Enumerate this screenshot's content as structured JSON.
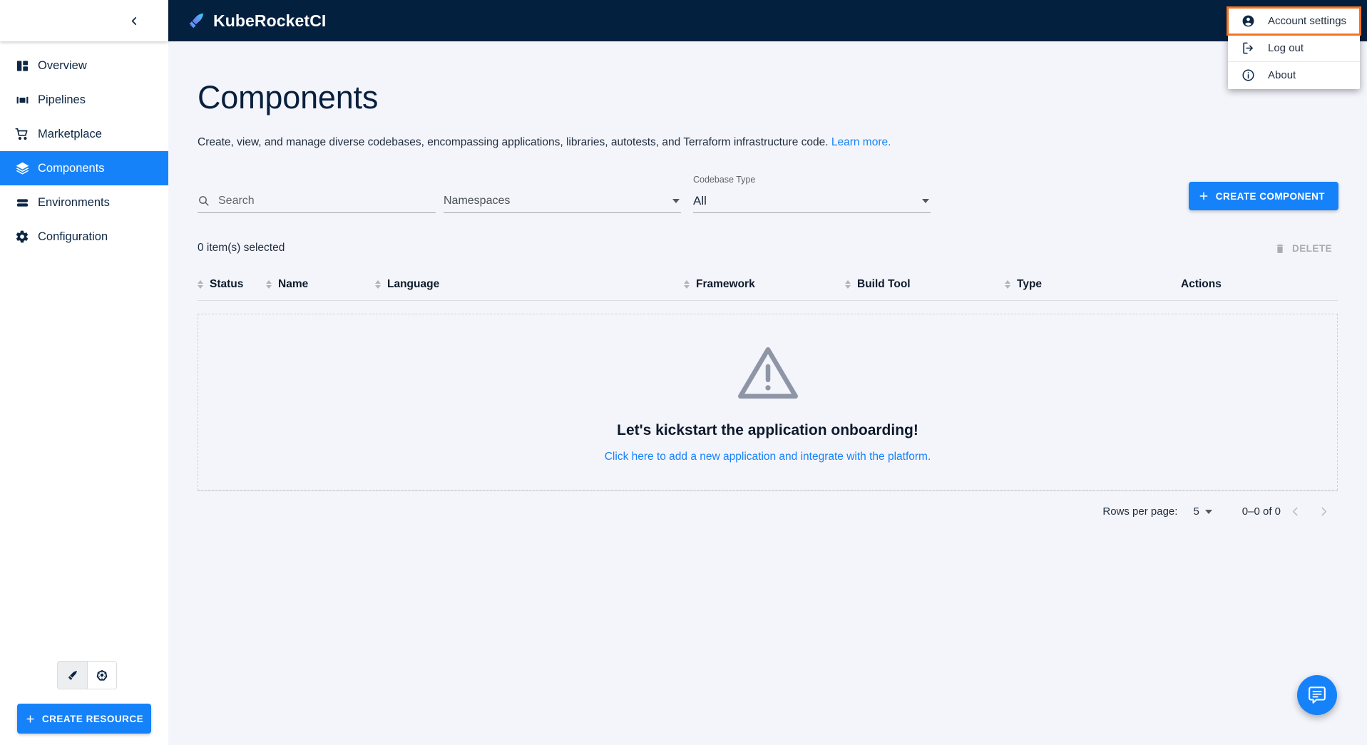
{
  "header": {
    "brand_title": "KubeRocketCI",
    "brand_logo_icon": "rocket-pen-icon"
  },
  "sidebar": {
    "collapse_icon": "chevron-left-icon",
    "items": [
      {
        "label": "Overview",
        "icon": "dashboard-icon",
        "active": false
      },
      {
        "label": "Pipelines",
        "icon": "pipeline-icon",
        "active": false
      },
      {
        "label": "Marketplace",
        "icon": "cart-icon",
        "active": false
      },
      {
        "label": "Components",
        "icon": "layers-icon",
        "active": true
      },
      {
        "label": "Environments",
        "icon": "stack-rows-icon",
        "active": false
      },
      {
        "label": "Configuration",
        "icon": "gear-icon",
        "active": false
      }
    ],
    "cluster_toggles": [
      {
        "icon": "kuberocketci-icon",
        "selected": true
      },
      {
        "icon": "kubernetes-icon",
        "selected": false
      }
    ],
    "create_resource_label": "CREATE RESOURCE",
    "create_resource_icon": "plus-icon"
  },
  "account_menu": {
    "items": [
      {
        "label": "Account settings",
        "icon": "account-circle-icon",
        "highlighted": true
      },
      {
        "label": "Log out",
        "icon": "logout-icon",
        "highlighted": false
      },
      {
        "label": "About",
        "icon": "info-circle-icon",
        "highlighted": false
      }
    ],
    "highlight_color": "#f47421"
  },
  "main": {
    "title": "Components",
    "description": "Create, view, and manage diverse codebases, encompassing applications, libraries, autotests, and Terraform infrastructure code.",
    "learn_more_label": "Learn more.",
    "filters": {
      "search_placeholder": "Search",
      "search_value": "",
      "search_icon": "search-icon",
      "namespaces_label": "Namespaces",
      "namespaces_value": "",
      "codebase_type_label": "Codebase Type",
      "codebase_type_value": "All",
      "dropdown_icon": "chevron-down-icon"
    },
    "create_component_label": "CREATE COMPONENT",
    "create_component_icon": "plus-icon",
    "selection_text": "0 item(s) selected",
    "delete_label": "DELETE",
    "delete_icon": "trash-icon",
    "table": {
      "columns": [
        {
          "label": "Status",
          "sortable": true
        },
        {
          "label": "Name",
          "sortable": true
        },
        {
          "label": "Language",
          "sortable": true
        },
        {
          "label": "Framework",
          "sortable": true
        },
        {
          "label": "Build Tool",
          "sortable": true
        },
        {
          "label": "Type",
          "sortable": true
        },
        {
          "label": "Actions",
          "sortable": false
        }
      ],
      "rows": [],
      "empty_state": {
        "icon": "warning-triangle-icon",
        "title": "Let's kickstart the application onboarding!",
        "link": "Click here to add a new application and integrate with the platform."
      }
    },
    "pagination": {
      "rows_per_page_label": "Rows per page:",
      "rows_per_page_value": "5",
      "range_label": "0–0 of 0",
      "prev_icon": "chevron-left-icon",
      "next_icon": "chevron-right-icon"
    },
    "fab_icon": "chat-bubble-icon"
  },
  "colors": {
    "accent": "#1682fa",
    "header_bg": "#04203f",
    "page_bg": "#f4f5fb",
    "highlight": "#f47421"
  }
}
